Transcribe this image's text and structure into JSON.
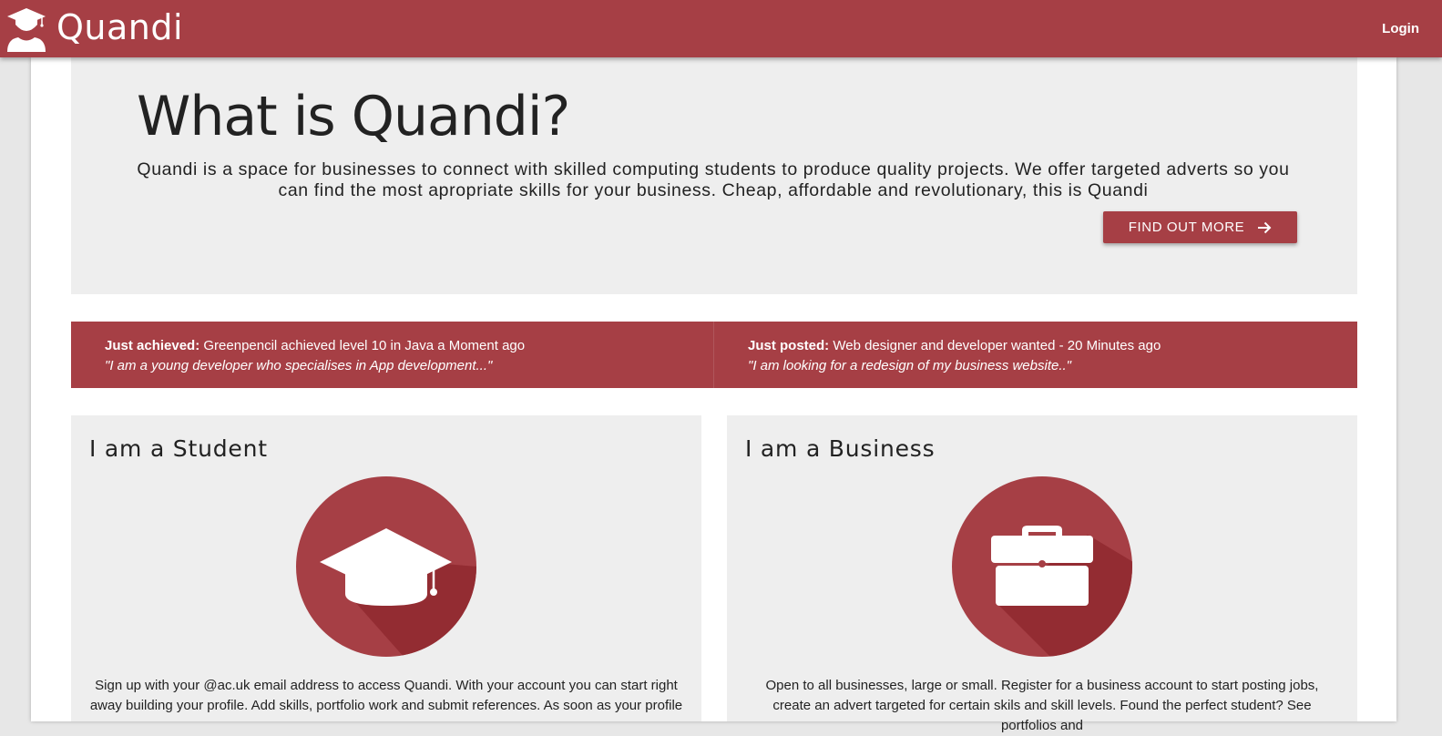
{
  "header": {
    "brand": "Quandi",
    "login_label": "Login"
  },
  "hero": {
    "title": "What is Quandi?",
    "text": "Quandi is a space for businesses to connect with skilled computing students to produce quality projects. We offer targeted adverts so you can find the most apropriate skills for your business. Cheap, affordable and revolutionary, this is Quandi",
    "button_label": "FIND OUT MORE"
  },
  "ticker": {
    "achieved": {
      "label": "Just achieved:",
      "text": " Greenpencil achieved level 10 in Java a Moment ago",
      "quote": "\"I am a young developer who specialises in App development...\""
    },
    "posted": {
      "label": "Just posted:",
      "text": " Web designer and developer wanted - 20 Minutes ago",
      "quote": "\"I am looking for a redesign of my business website..\""
    }
  },
  "cards": {
    "student": {
      "title": "I am a Student",
      "icon": "graduation-cap-icon",
      "text": "Sign up with your @ac.uk email address to access Quandi. With your account you can start right away building your profile. Add skills, portfolio work and submit references. As soon as your profile"
    },
    "business": {
      "title": "I am a Business",
      "icon": "briefcase-icon",
      "text": "Open to all businesses, large or small. Register for a business account to start posting jobs, create an advert targeted for certain skils and skill levels. Found the perfect student? See portfolios and"
    }
  },
  "colors": {
    "brand": "#a63f45",
    "brand_dark": "#932c32",
    "panel": "#eeeeee",
    "page_bg": "#e7e7e7"
  }
}
